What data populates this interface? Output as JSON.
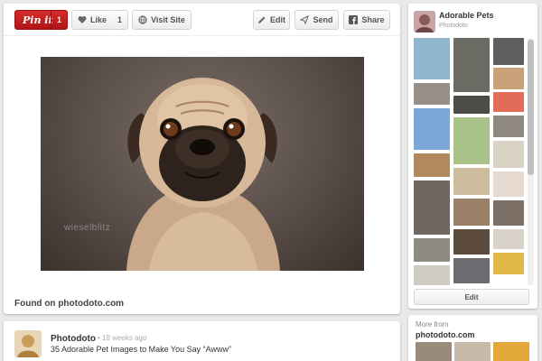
{
  "toolbar": {
    "pinit_label": "Pin it",
    "pinit_count": "1",
    "like_label": "Like",
    "like_count": "1",
    "visit_label": "Visit Site",
    "edit_label": "Edit",
    "send_label": "Send",
    "share_label": "Share"
  },
  "pin": {
    "watermark": "wieselblitz",
    "found_on": "Found on photodoto.com"
  },
  "comment": {
    "author": "Photodoto",
    "time": "• 19 weeks ago",
    "text": "35 Adorable Pet Images to Make You Say “Awww”"
  },
  "board": {
    "title": "Adorable Pets",
    "owner": "Photodoto",
    "edit_label": "Edit"
  },
  "more": {
    "title": "More from",
    "source": "photodoto.com"
  },
  "colors": {
    "pinit_red": "#c31a1a",
    "background": "#e9e9e9"
  },
  "icons": {
    "like": "heart-icon",
    "visit": "globe-icon",
    "edit": "pencil-icon",
    "send": "paper-plane-icon",
    "share": "facebook-icon"
  }
}
